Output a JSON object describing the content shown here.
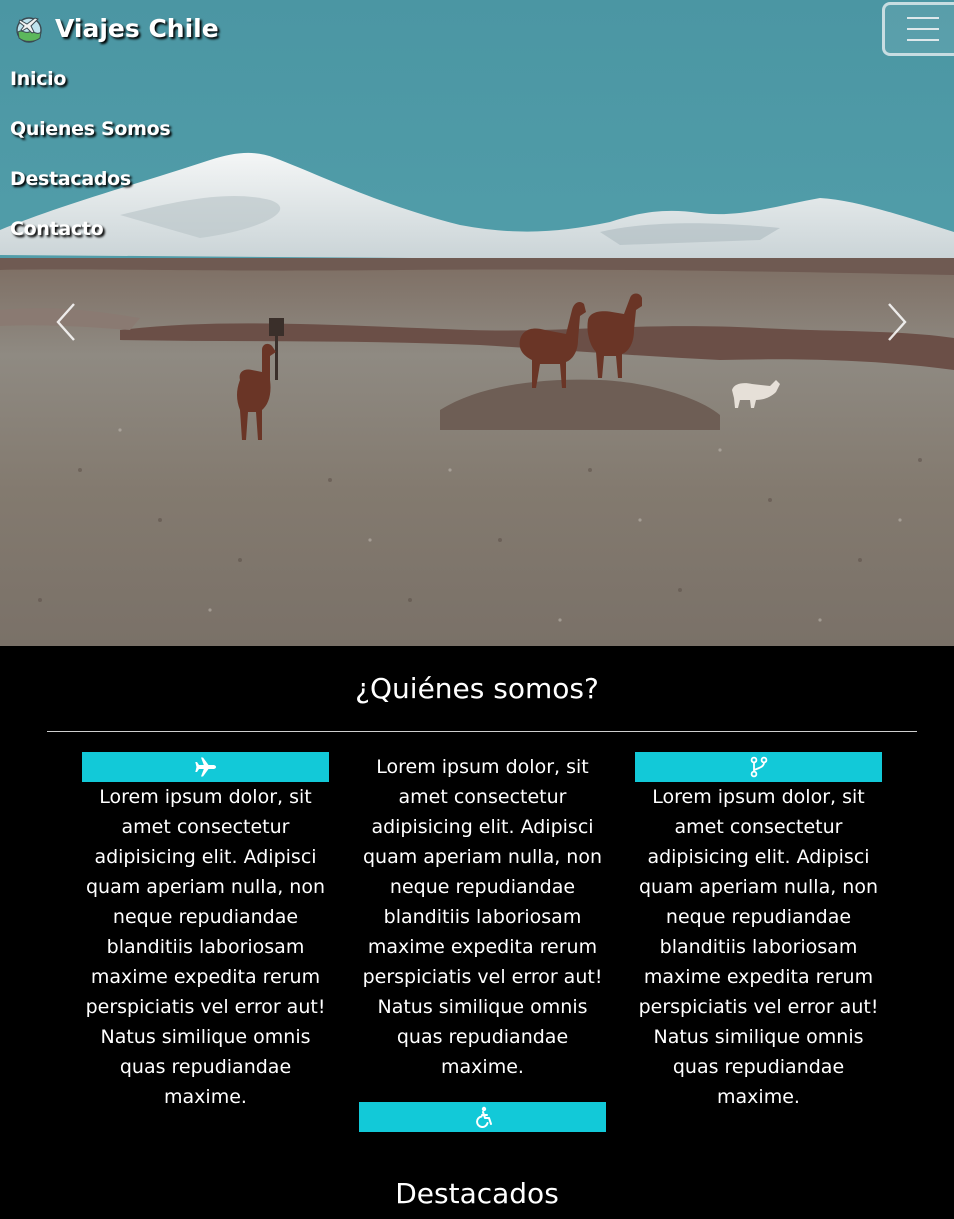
{
  "brand": {
    "name": "Viajes Chile"
  },
  "nav": {
    "items": [
      {
        "label": "Inicio"
      },
      {
        "label": "Quienes Somos"
      },
      {
        "label": "Destacados"
      },
      {
        "label": "Contacto"
      }
    ]
  },
  "hero": {
    "prev_icon": "chevron-left-icon",
    "next_icon": "chevron-right-icon"
  },
  "quienes": {
    "title": "¿Quiénes somos?",
    "columns": [
      {
        "icon": "plane-icon",
        "text": "Lorem ipsum dolor, sit amet consectetur adipisicing elit. Adipisci quam aperiam nulla, non neque repudiandae blanditiis laboriosam maxime expedita rerum perspiciatis vel error aut! Natus similique omnis quas repudiandae maxime."
      },
      {
        "icon": "accessibility-icon",
        "text": "Lorem ipsum dolor, sit amet consectetur adipisicing elit. Adipisci quam aperiam nulla, non neque repudiandae blanditiis laboriosam maxime expedita rerum perspiciatis vel error aut! Natus similique omnis quas repudiandae maxime."
      },
      {
        "icon": "branch-icon",
        "text": "Lorem ipsum dolor, sit amet consectetur adipisicing elit. Adipisci quam aperiam nulla, non neque repudiandae blanditiis laboriosam maxime expedita rerum perspiciatis vel error aut! Natus similique omnis quas repudiandae maxime."
      }
    ]
  },
  "destacados": {
    "title": "Destacados"
  },
  "colors": {
    "accent": "#12c9d8",
    "background": "#000000"
  }
}
